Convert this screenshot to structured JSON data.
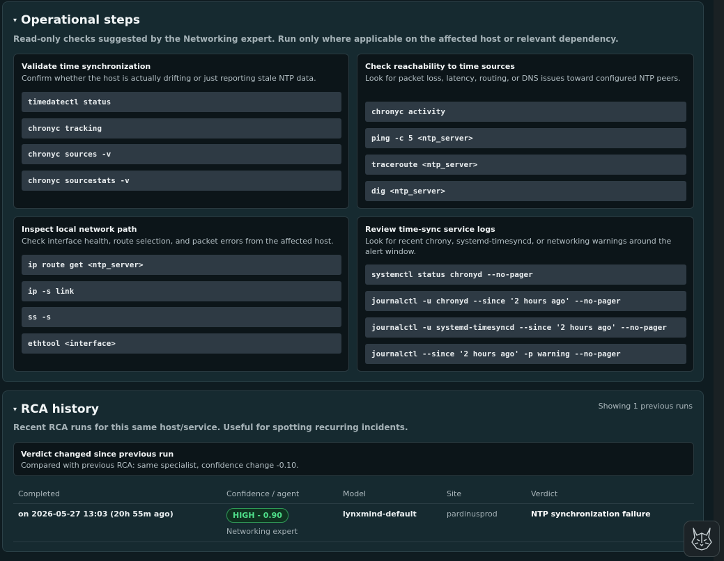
{
  "operational": {
    "title": "Operational steps",
    "subtitle": "Read-only checks suggested by the Networking expert. Run only where applicable on the affected host or relevant dependency.",
    "cards": [
      {
        "title": "Validate time synchronization",
        "desc": "Confirm whether the host is actually drifting or just reporting stale NTP data.",
        "commands": [
          "timedatectl status",
          "chronyc tracking",
          "chronyc sources -v",
          "chronyc sourcestats -v"
        ]
      },
      {
        "title": "Check reachability to time sources",
        "desc": "Look for packet loss, latency, routing, or DNS issues toward configured NTP peers.",
        "commands": [
          "chronyc activity",
          "ping -c 5 <ntp_server>",
          "traceroute <ntp_server>",
          "dig <ntp_server>"
        ]
      },
      {
        "title": "Inspect local network path",
        "desc": "Check interface health, route selection, and packet errors from the affected host.",
        "commands": [
          "ip route get <ntp_server>",
          "ip -s link",
          "ss -s",
          "ethtool <interface>"
        ]
      },
      {
        "title": "Review time-sync service logs",
        "desc": "Look for recent chrony, systemd-timesyncd, or networking warnings around the alert window.",
        "commands": [
          "systemctl status chronyd --no-pager",
          "journalctl -u chronyd --since '2 hours ago' --no-pager",
          "journalctl -u systemd-timesyncd --since '2 hours ago' --no-pager",
          "journalctl --since '2 hours ago' -p warning --no-pager"
        ]
      }
    ]
  },
  "rca": {
    "title": "RCA history",
    "subtitle": "Recent RCA runs for this same host/service. Useful for spotting recurring incidents.",
    "runs_count": "Showing 1 previous runs",
    "verdict_change": {
      "title": "Verdict changed since previous run",
      "desc": "Compared with previous RCA: same specialist, confidence change -0.10."
    },
    "columns": [
      "Completed",
      "Confidence / agent",
      "Model",
      "Site",
      "Verdict"
    ],
    "rows": [
      {
        "completed": "on 2026-05-27 13:03 (20h 55m ago)",
        "confidence": "HIGH - 0.90",
        "agent": "Networking expert",
        "model": "lynxmind-default",
        "site": "pardinusprod",
        "verdict": "NTP synchronization failure"
      }
    ]
  },
  "colors": {
    "background": "#0f1c21",
    "panel": "#162a30",
    "card": "#0c1519",
    "command": "#2e3a44",
    "badge_green": "#4fe08a"
  },
  "icons": {
    "caret": "▾",
    "logo": "lynx-logo-icon"
  }
}
